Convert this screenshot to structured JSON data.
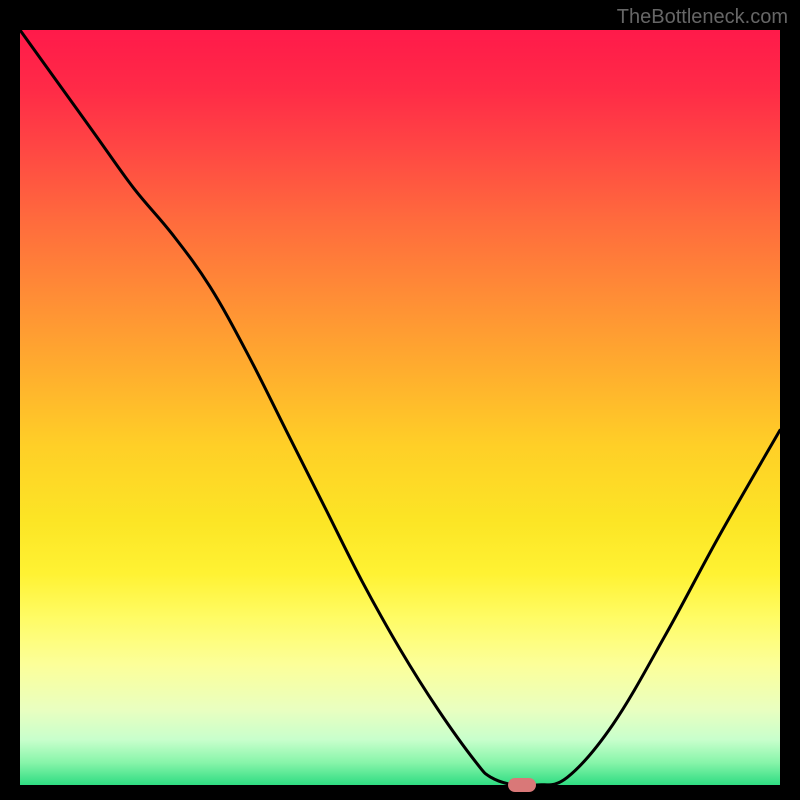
{
  "watermark": "TheBottleneck.com",
  "chart_data": {
    "type": "line",
    "title": "",
    "xlabel": "",
    "ylabel": "",
    "xlim": [
      0,
      100
    ],
    "ylim": [
      0,
      100
    ],
    "grid": false,
    "background": "red-yellow-green vertical gradient",
    "x": [
      0,
      5,
      10,
      15,
      20,
      25,
      30,
      35,
      40,
      45,
      50,
      55,
      60,
      62,
      65,
      68,
      72,
      78,
      85,
      92,
      100
    ],
    "values": [
      100,
      93,
      86,
      79,
      73,
      66,
      57,
      47,
      37,
      27,
      18,
      10,
      3,
      1,
      0,
      0,
      1,
      8,
      20,
      33,
      47
    ],
    "marker": {
      "x": 66,
      "y": 0,
      "color": "#d97878"
    },
    "curve_color": "#000000"
  },
  "colors": {
    "background": "#000000",
    "gradient_top": "#ff1a4a",
    "gradient_mid": "#ffcf27",
    "gradient_bottom": "#2fdc82",
    "curve": "#000000",
    "marker": "#d97878",
    "watermark": "#666666"
  }
}
